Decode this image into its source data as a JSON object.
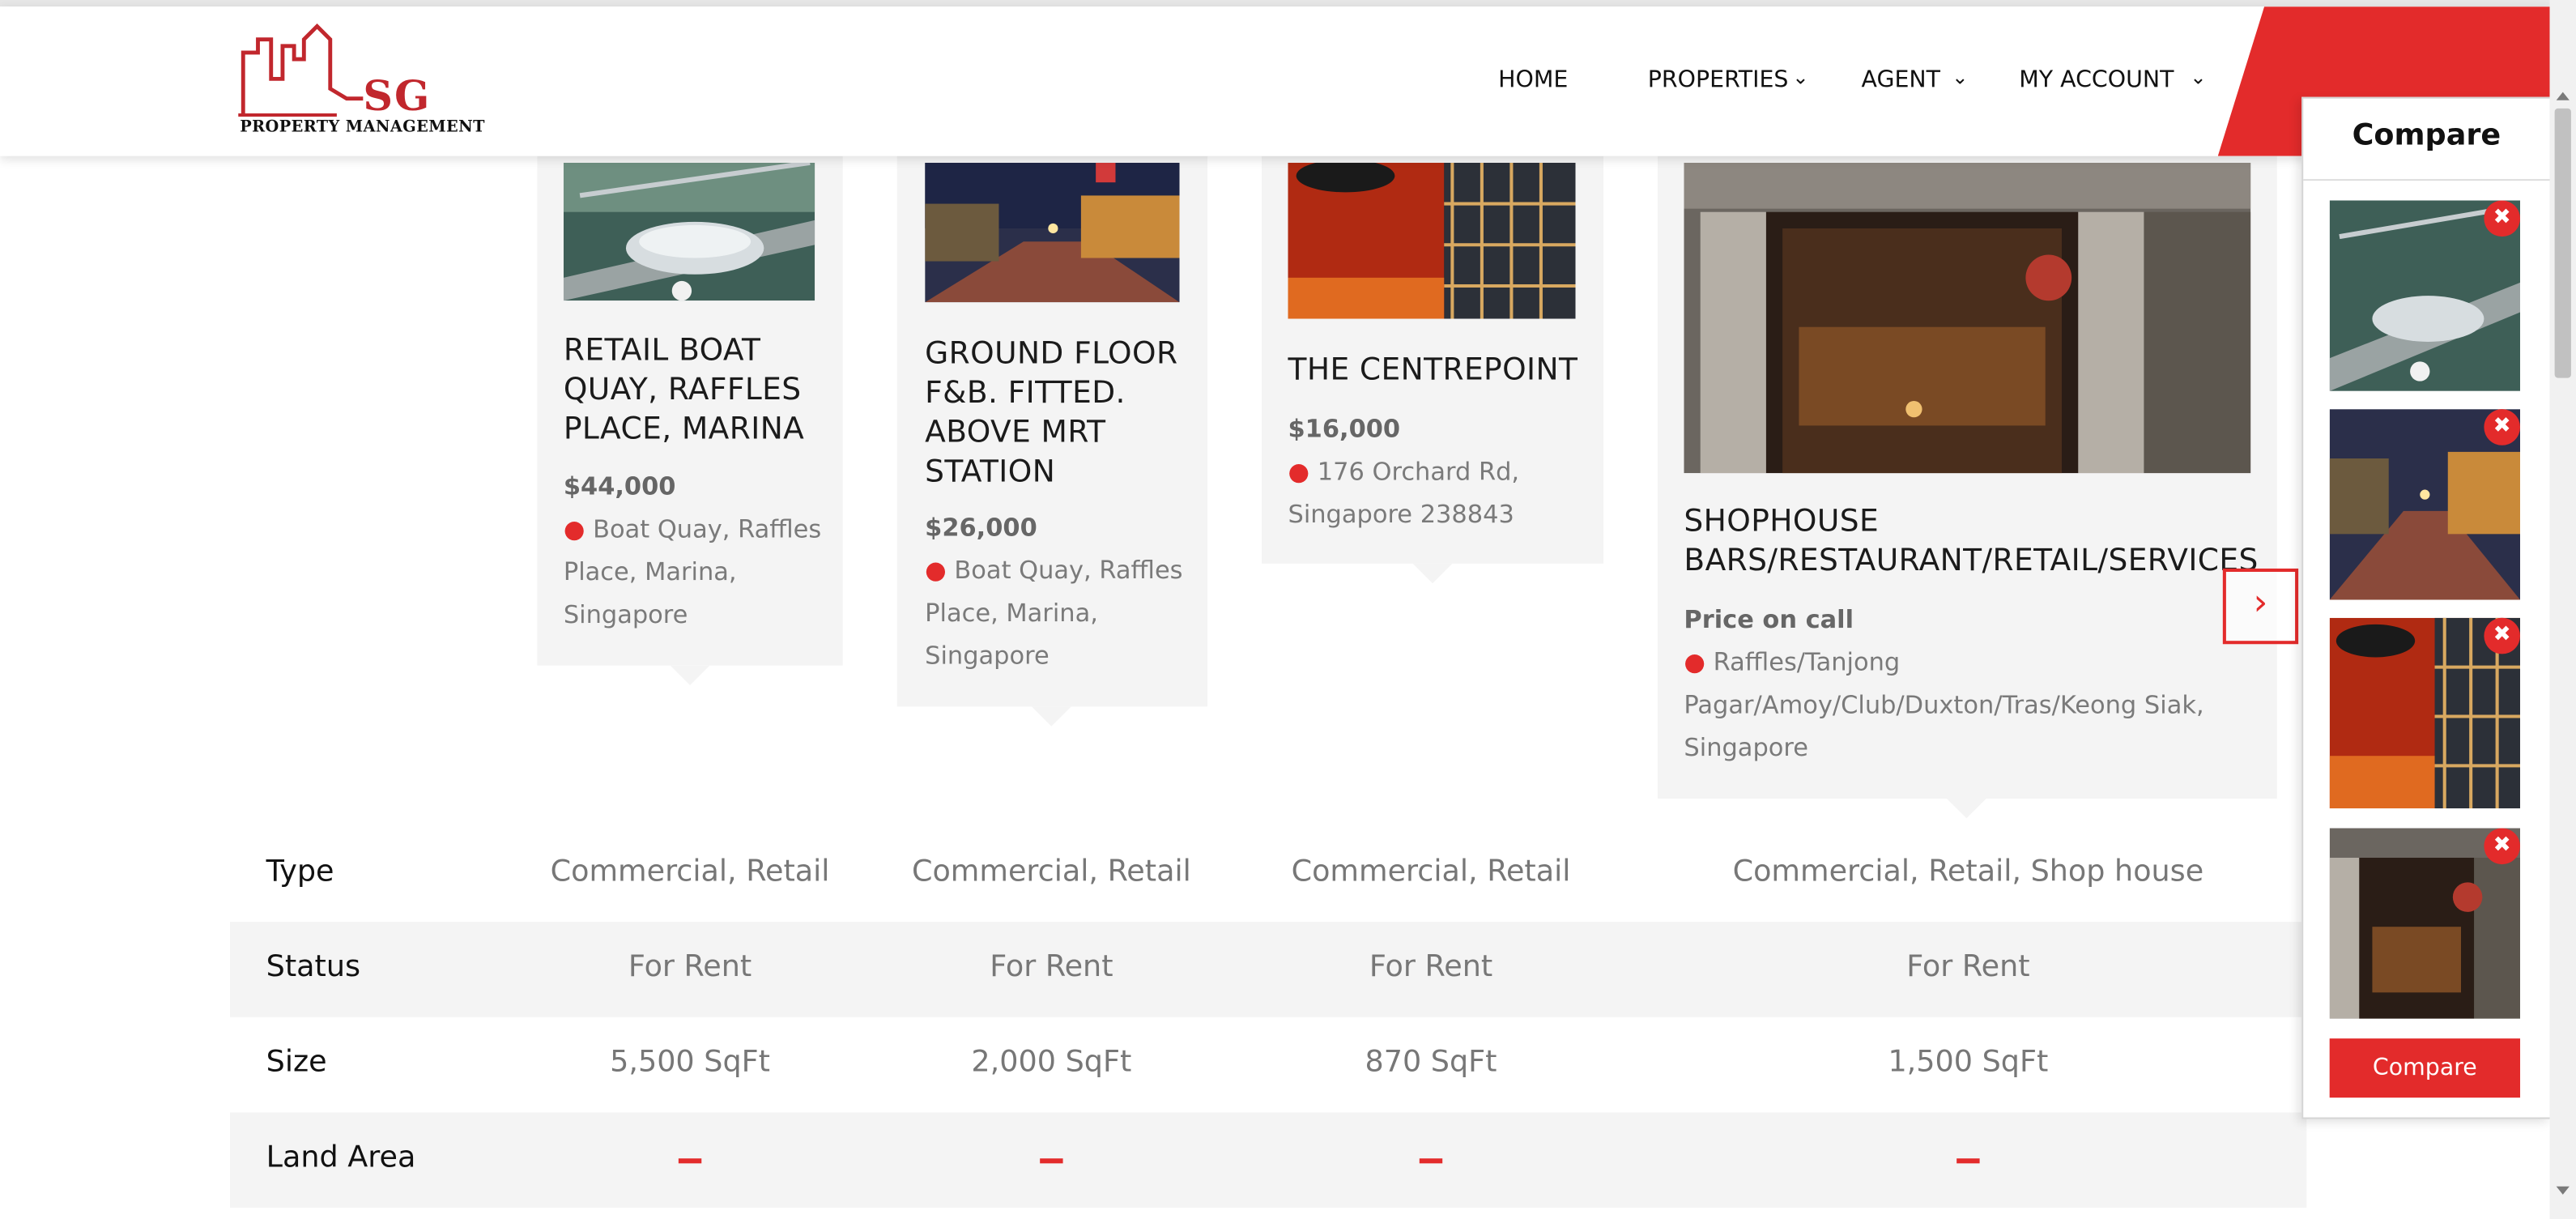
{
  "brand": {
    "logo_text": "SG",
    "logo_subtext": "PROPERTY MANAGEMENT",
    "accent_color": "#e32b2b"
  },
  "nav": {
    "home": "HOME",
    "properties": "PROPERTIES",
    "agent": "AGENT",
    "my_account": "MY ACCOUNT",
    "caret_icon": "chevron-down-icon"
  },
  "properties": [
    {
      "title": "RETAIL BOAT QUAY, RAFFLES PLACE, MARINA",
      "price": "$44,000",
      "address": "Boat Quay, Raffles Place, Marina, Singapore",
      "image": "marina-bay-aerial"
    },
    {
      "title": "GROUND FLOOR F&B. FITTED. ABOVE MRT STATION",
      "price": "$26,000",
      "address": "Boat Quay, Raffles Place, Marina, Singapore",
      "image": "street-night-shops"
    },
    {
      "title": "THE CENTREPOINT",
      "price": "$16,000",
      "address": "176 Orchard Rd, Singapore 238843",
      "image": "mall-red-interior"
    },
    {
      "title": "SHOPHOUSE BARS/RESTAURANT/RETAIL/SERVICES",
      "price": "Price on call",
      "address": "Raffles/Tanjong Pagar/Amoy/Club/Duxton/Tras/Keong Siak, Singapore",
      "image": "pure-bar-entrance"
    }
  ],
  "table": {
    "rows": [
      {
        "label": "Type",
        "values": [
          "Commercial, Retail",
          "Commercial, Retail",
          "Commercial, Retail",
          "Commercial, Retail, Shop house"
        ]
      },
      {
        "label": "Status",
        "values": [
          "For Rent",
          "For Rent",
          "For Rent",
          "For Rent"
        ]
      },
      {
        "label": "Size",
        "values": [
          "5,500 SqFt",
          "2,000 SqFt",
          "870 SqFt",
          "1,500 SqFt"
        ]
      },
      {
        "label": "Land Area",
        "values": [
          "",
          "",
          "",
          ""
        ]
      }
    ]
  },
  "compare_panel": {
    "title": "Compare",
    "button_label": "Compare",
    "remove_icon": "close-icon"
  },
  "icons": {
    "pin": "map-pin-icon",
    "next": "chevron-right-icon"
  }
}
